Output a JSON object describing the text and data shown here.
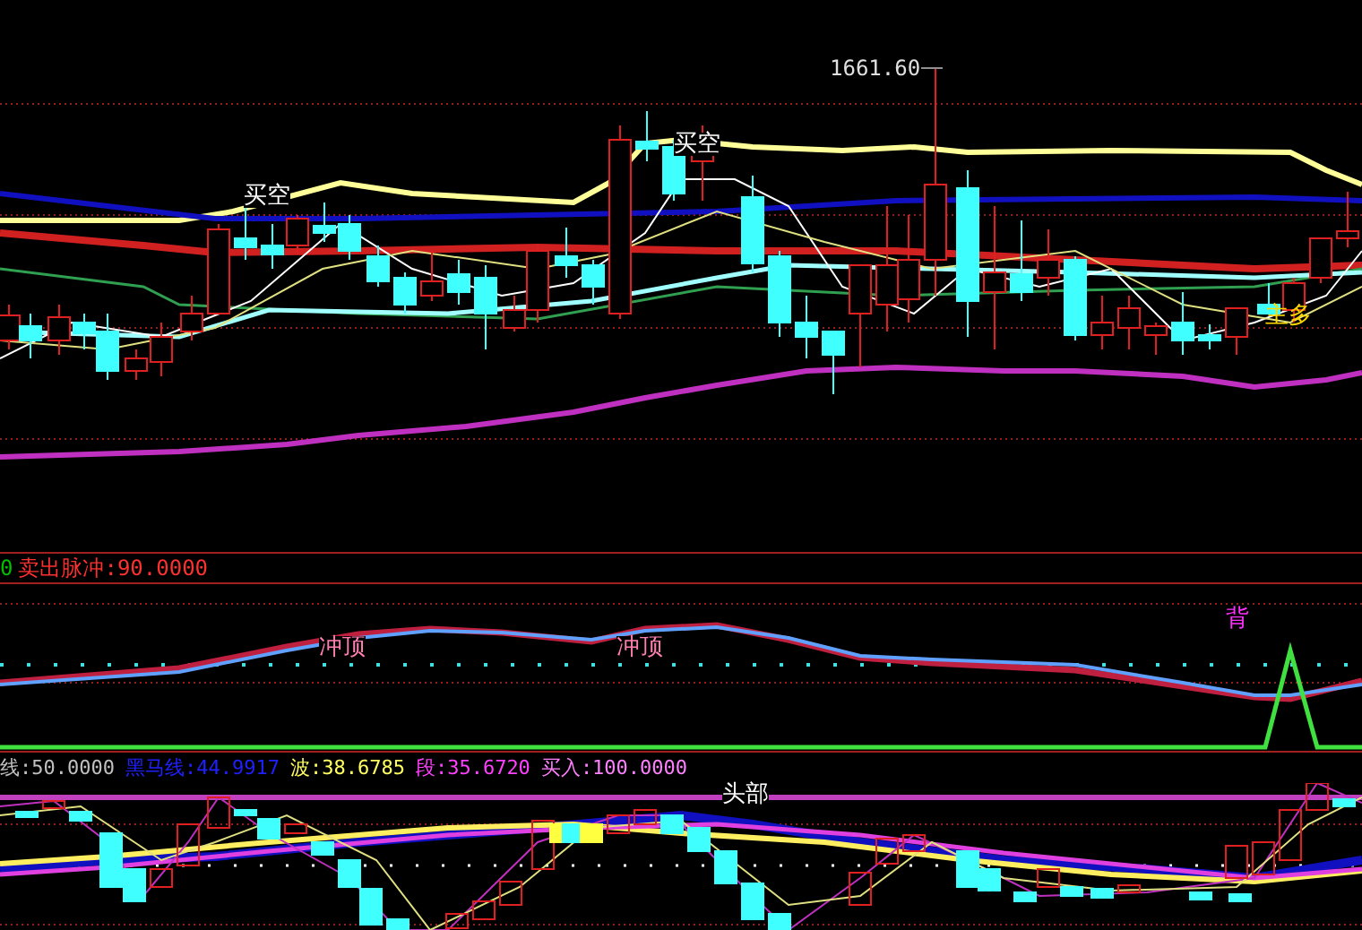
{
  "price_panel": {
    "high_label": "1661.60",
    "signals": [
      {
        "text": "买空",
        "kind": "sell"
      },
      {
        "text": "买空",
        "kind": "sell"
      },
      {
        "text": "主多",
        "kind": "buy"
      }
    ]
  },
  "pulse_panel": {
    "legend": [
      {
        "text": "0",
        "color": "#00c000"
      },
      {
        "text": "卖出脉冲:90.0000",
        "color": "#ff3030"
      }
    ],
    "labels": [
      {
        "text": "冲顶",
        "kind": "top"
      },
      {
        "text": "冲顶",
        "kind": "top"
      },
      {
        "text": "背",
        "kind": "divergence"
      }
    ]
  },
  "wave_panel": {
    "legend": [
      {
        "text": "线:50.0000",
        "color": "#c0c0c0"
      },
      {
        "text": "黑马线:44.9917",
        "color": "#2020ff"
      },
      {
        "text": "波:38.6785",
        "color": "#ffff60"
      },
      {
        "text": "段:35.6720",
        "color": "#ff40ff"
      },
      {
        "text": "买入:100.0000",
        "color": "#ff80ff"
      }
    ],
    "labels": [
      {
        "text": "头部",
        "kind": "head"
      }
    ]
  }
}
